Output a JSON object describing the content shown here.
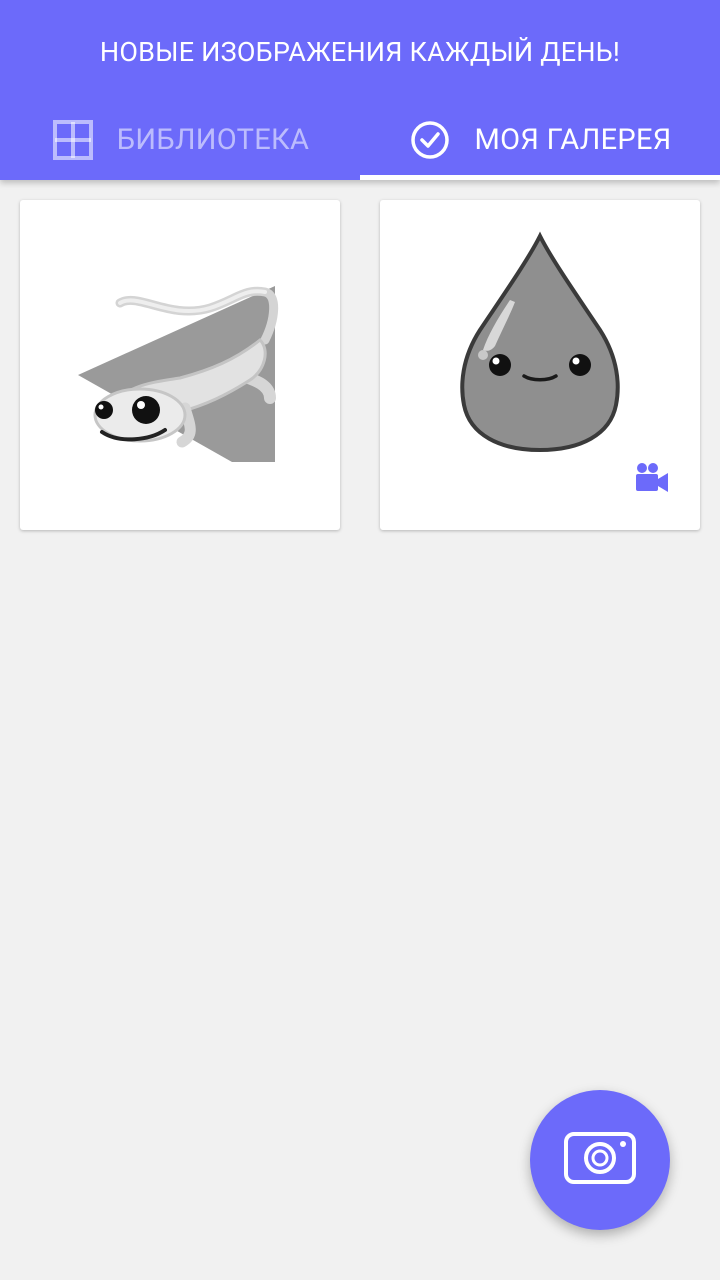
{
  "header": {
    "banner_text": "НОВЫЕ ИЗОБРАЖЕНИЯ КАЖДЫЙ ДЕНЬ!",
    "background_color": "#6c6afa"
  },
  "tabs": [
    {
      "label": "БИБЛИОТЕКА",
      "icon": "grid-icon",
      "selected": false
    },
    {
      "label": "МОЯ ГАЛЕРЕЯ",
      "icon": "check-circle-icon",
      "selected": true
    }
  ],
  "gallery": {
    "items": [
      {
        "subject": "lizard-artwork",
        "has_video": false
      },
      {
        "subject": "water-drop-artwork",
        "has_video": true,
        "badge_icon": "video-camera-icon"
      }
    ]
  },
  "fab": {
    "icon": "camera-icon",
    "color": "#6c6afa"
  },
  "colors": {
    "accent": "#6c6afa",
    "background": "#f1f1f1",
    "card": "#ffffff"
  }
}
